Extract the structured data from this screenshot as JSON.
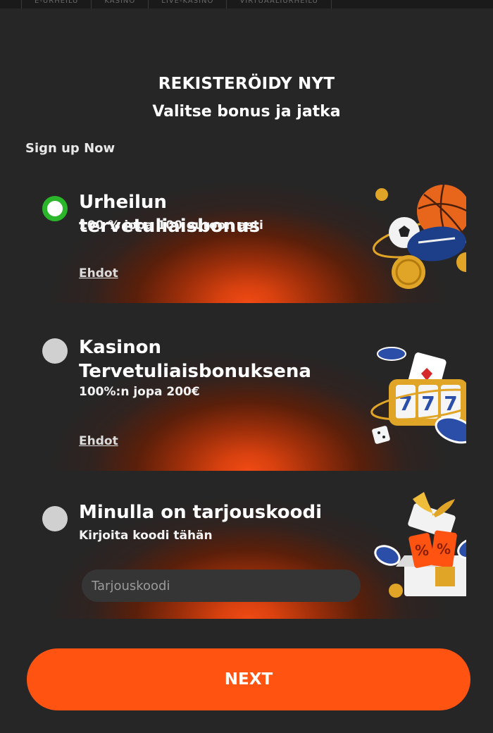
{
  "topnav": {
    "items": [
      "E-URHEILU",
      "KASINO",
      "LIVE-KASINO",
      "VIRTUAALIURHEILU"
    ]
  },
  "header": {
    "title": "REKISTERÖIDY NYT",
    "subtitle": "Valitse bonus ja jatka"
  },
  "signup_label": "Sign up Now",
  "options": [
    {
      "title": "Urheilun tervetuliaisbonus",
      "subtitle": "100 % jopa 100 euroon asti",
      "terms": "Ehdot",
      "selected": true,
      "icon": "sports-balls-icon"
    },
    {
      "title": "Kasinon Tervetuliaisbonuksena",
      "subtitle": "100%:n jopa 200€",
      "terms": "Ehdot",
      "selected": false,
      "icon": "slot-machine-icon"
    },
    {
      "title": "Minulla on tarjouskoodi",
      "subtitle": "Kirjoita koodi tähän",
      "input_placeholder": "Tarjouskoodi",
      "input_value": "",
      "selected": false,
      "icon": "gift-box-icon"
    }
  ],
  "next_button": "NEXT",
  "colors": {
    "background": "#262626",
    "accent": "#ff5312",
    "selected_radio": "#2bb52b"
  }
}
